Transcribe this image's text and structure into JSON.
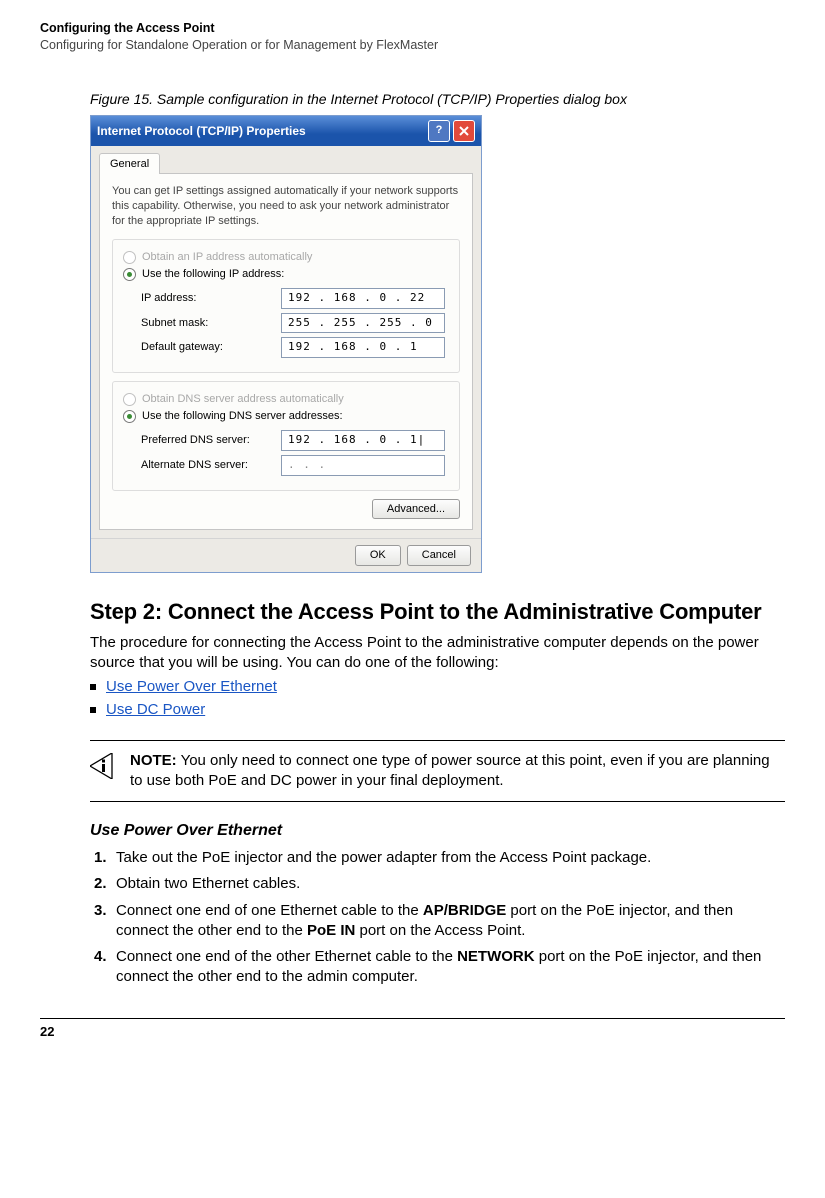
{
  "header": {
    "bold": "Configuring the Access Point",
    "sub": "Configuring for Standalone Operation or for Management by FlexMaster"
  },
  "figure": {
    "caption": "Figure 15.    Sample configuration in the Internet Protocol (TCP/IP) Properties dialog box"
  },
  "dialog": {
    "title": "Internet Protocol (TCP/IP) Properties",
    "help_icon": "help-icon",
    "close_icon": "close-icon",
    "tab": "General",
    "desc": "You can get IP settings assigned automatically if your network supports this capability. Otherwise, you need to ask your network administrator for the appropriate IP settings.",
    "ip": {
      "auto": "Obtain an IP address automatically",
      "manual": "Use the following IP address:",
      "fields": {
        "ip_label": "IP address:",
        "ip_value": "192 . 168 .  0  .  22",
        "mask_label": "Subnet mask:",
        "mask_value": "255 . 255 . 255 .  0",
        "gw_label": "Default gateway:",
        "gw_value": "192 . 168 .  0  .  1"
      }
    },
    "dns": {
      "auto": "Obtain DNS server address automatically",
      "manual": "Use the following DNS server addresses:",
      "fields": {
        "pref_label": "Preferred DNS server:",
        "pref_value": "192 . 168 .  0  .  1|",
        "alt_label": "Alternate DNS server:",
        "alt_value": ".       .       ."
      }
    },
    "advanced": "Advanced...",
    "ok": "OK",
    "cancel": "Cancel"
  },
  "section": {
    "h2": "Step 2: Connect the Access Point to the Administrative Computer",
    "intro": "The procedure for connecting the Access Point to the administrative computer depends on the power source that you will be using. You can do one of the following:",
    "links": {
      "poe": "Use Power Over Ethernet",
      "dc": "Use DC Power"
    }
  },
  "note": {
    "label": "NOTE:",
    "text": "  You only need to connect one type of power source at this point, even if you are planning to use both PoE and DC power in your final deployment."
  },
  "sub": {
    "h3": "Use Power Over Ethernet",
    "steps": {
      "s1": "Take out the PoE injector and the power adapter from the Access Point package.",
      "s2": "Obtain two Ethernet cables.",
      "s3a": "Connect one end of one Ethernet cable to the ",
      "s3b": "AP/BRIDGE",
      "s3c": " port on the PoE injector, and then connect the other end to the ",
      "s3d": "PoE IN",
      "s3e": " port on the Access Point.",
      "s4a": "Connect one end of the other Ethernet cable to the ",
      "s4b": "NETWORK",
      "s4c": " port on the PoE injector, and then connect the other end to the admin computer."
    }
  },
  "page_number": "22"
}
